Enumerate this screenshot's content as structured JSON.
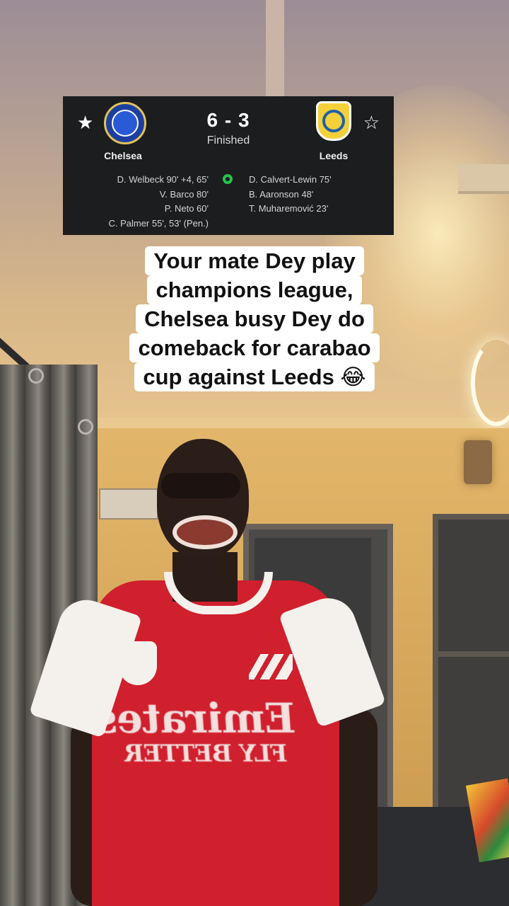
{
  "score_card": {
    "home_team": "Chelsea",
    "away_team": "Leeds",
    "score": "6 - 3",
    "status": "Finished",
    "home_scorers": [
      "D. Welbeck 90' +4, 65'",
      "V. Barco 80'",
      "P. Neto 60'",
      "C. Palmer 55', 53' (Pen.)"
    ],
    "away_scorers": [
      "D. Calvert-Lewin 75'",
      "B. Aaronson 48'",
      "T. Muharemović 23'"
    ],
    "home_favorite_icon": "star-filled-icon",
    "away_favorite_icon": "star-outline-icon",
    "goal_icon": "football-icon",
    "goal_icon_color": "#27c24c"
  },
  "caption": {
    "lines": [
      "Your mate Dey play",
      "champions league,",
      "Chelsea busy Dey do",
      "comeback for carabao",
      "cup against Leeds 😂"
    ]
  },
  "shirt_text": {
    "sponsor": "Emirates",
    "sponsor_sub": "FLY BETTER"
  }
}
